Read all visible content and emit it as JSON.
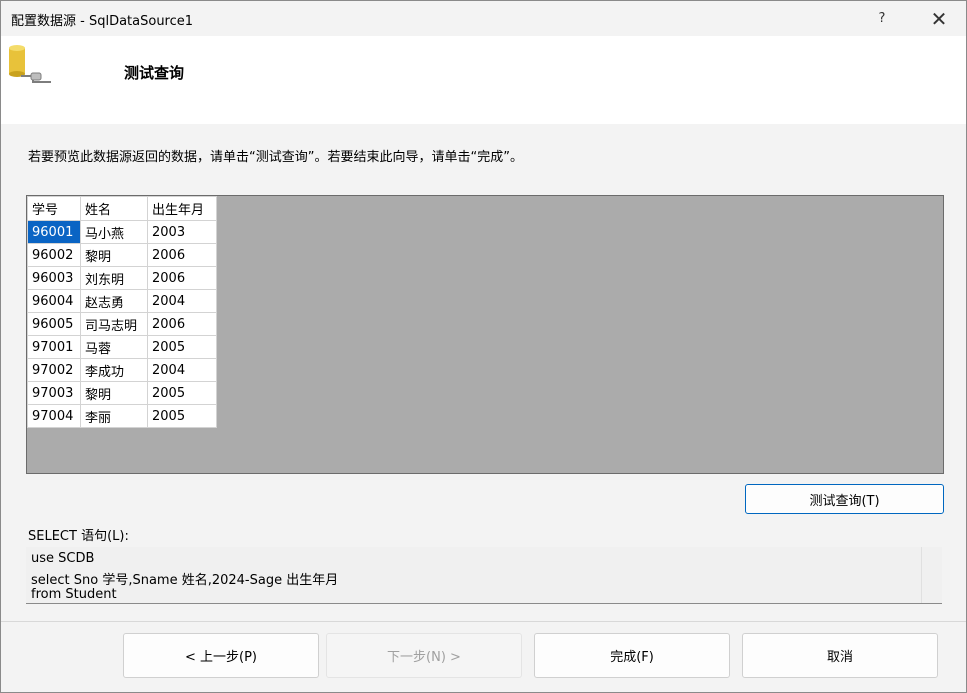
{
  "window": {
    "title": "配置数据源 - SqlDataSource1",
    "help": "?",
    "close": "✕"
  },
  "header": {
    "title": "测试查询",
    "icon": "database-connection-icon"
  },
  "instruction": "若要预览此数据源返回的数据，请单击“测试查询”。若要结束此向导，请单击“完成”。",
  "grid": {
    "columns": [
      "学号",
      "姓名",
      "出生年月"
    ],
    "rows": [
      [
        "96001",
        "马小燕",
        "2003"
      ],
      [
        "96002",
        "黎明",
        "2006"
      ],
      [
        "96003",
        "刘东明",
        "2006"
      ],
      [
        "96004",
        "赵志勇",
        "2004"
      ],
      [
        "96005",
        "司马志明",
        "2006"
      ],
      [
        "97001",
        "马蓉",
        "2005"
      ],
      [
        "97002",
        "李成功",
        "2004"
      ],
      [
        "97003",
        "黎明",
        "2005"
      ],
      [
        "97004",
        "李丽",
        "2005"
      ]
    ]
  },
  "test_button": "测试查询(T)",
  "sql": {
    "label": "SELECT 语句(L):",
    "lines": [
      "use SCDB",
      "select Sno 学号,Sname 姓名,2024-Sage 出生年月",
      "from Student"
    ]
  },
  "buttons": {
    "prev": "< 上一步(P)",
    "next": "下一步(N) >",
    "finish": "完成(F)",
    "cancel": "取消"
  },
  "colors": {
    "selection": "#0a64c4",
    "accent_border": "#0067c0",
    "grid_bg": "#ababab"
  }
}
